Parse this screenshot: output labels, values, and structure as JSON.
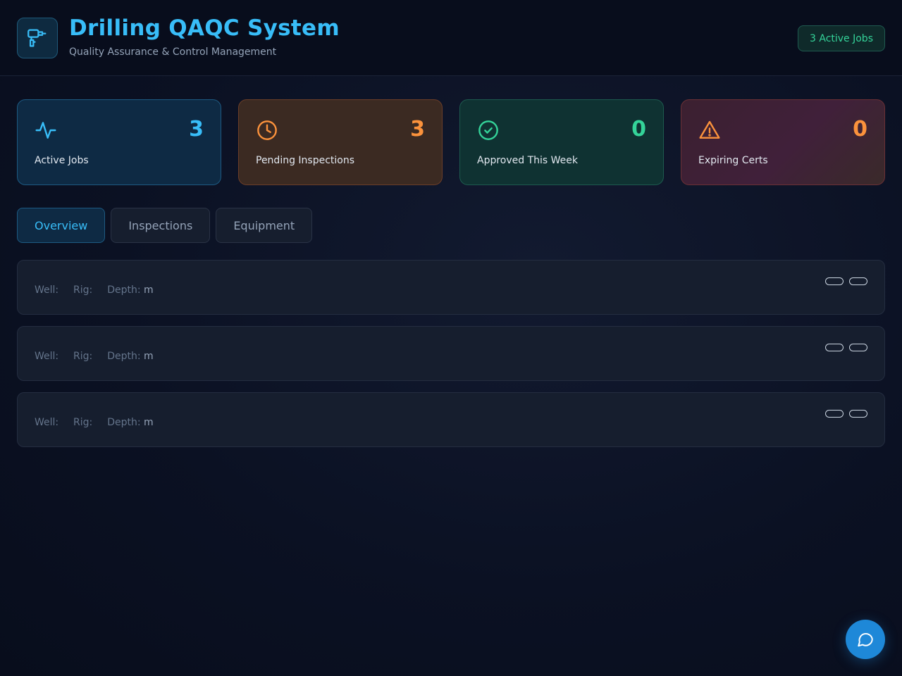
{
  "header": {
    "title": "Drilling QAQC System",
    "subtitle": "Quality Assurance & Control Management",
    "badge": "3 Active Jobs",
    "logo_icon": "drill-icon"
  },
  "stats": [
    {
      "icon": "activity-icon",
      "value": "3",
      "label": "Active Jobs",
      "color": "#38bdf8"
    },
    {
      "icon": "clock-icon",
      "value": "3",
      "label": "Pending Inspections",
      "color": "#fb923c"
    },
    {
      "icon": "check-circle-icon",
      "value": "0",
      "label": "Approved This Week",
      "color": "#34d399"
    },
    {
      "icon": "alert-triangle-icon",
      "value": "0",
      "label": "Expiring Certs",
      "color": "#fb923c"
    }
  ],
  "tabs": [
    {
      "label": "Overview",
      "active": true
    },
    {
      "label": "Inspections",
      "active": false
    },
    {
      "label": "Equipment",
      "active": false
    }
  ],
  "jobs": [
    {
      "well_label": "Well:",
      "well": "",
      "rig_label": "Rig:",
      "rig": "",
      "depth_label": "Depth:",
      "depth": "m"
    },
    {
      "well_label": "Well:",
      "well": "",
      "rig_label": "Rig:",
      "rig": "",
      "depth_label": "Depth:",
      "depth": "m"
    },
    {
      "well_label": "Well:",
      "well": "",
      "rig_label": "Rig:",
      "rig": "",
      "depth_label": "Depth:",
      "depth": "m"
    }
  ],
  "fab": {
    "icon": "chat-icon"
  },
  "colors": {
    "accent": "#38bdf8",
    "fab": "#1e88d8"
  }
}
